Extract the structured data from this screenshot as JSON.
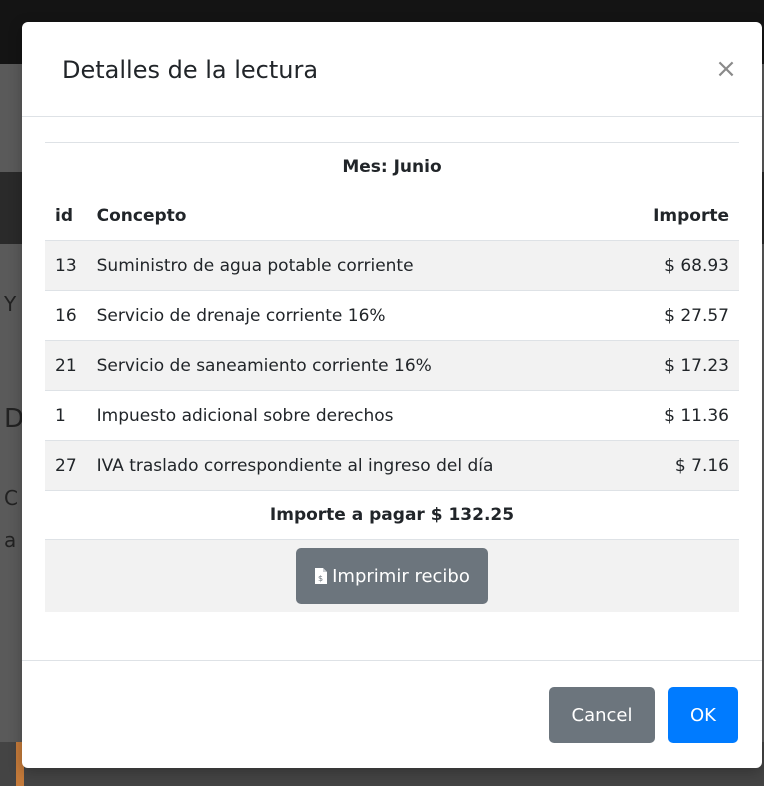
{
  "modal": {
    "title": "Detalles de la lectura",
    "close_glyph": "×",
    "month_label": "Mes: Junio",
    "columns": {
      "id": "id",
      "concept": "Concepto",
      "amount": "Importe"
    },
    "rows": [
      {
        "id": "13",
        "concept": "Suministro de agua potable corriente",
        "amount": "$ 68.93"
      },
      {
        "id": "16",
        "concept": "Servicio de drenaje corriente 16%",
        "amount": "$ 27.57"
      },
      {
        "id": "21",
        "concept": "Servicio de saneamiento corriente 16%",
        "amount": "$ 17.23"
      },
      {
        "id": "1",
        "concept": "Impuesto adicional sobre derechos",
        "amount": "$ 11.36"
      },
      {
        "id": "27",
        "concept": "IVA traslado correspondiente al ingreso del día",
        "amount": "$ 7.16"
      }
    ],
    "total_label": "Importe a pagar $ 132.25",
    "print_button": {
      "label": "Imprimir recibo",
      "icon": "file-invoice-icon"
    },
    "footer": {
      "cancel_label": "Cancel",
      "ok_label": "OK"
    }
  },
  "colors": {
    "primary": "#007bff",
    "secondary": "#6c757d",
    "striped_row": "#f2f2f2",
    "border": "#dee2e6"
  }
}
